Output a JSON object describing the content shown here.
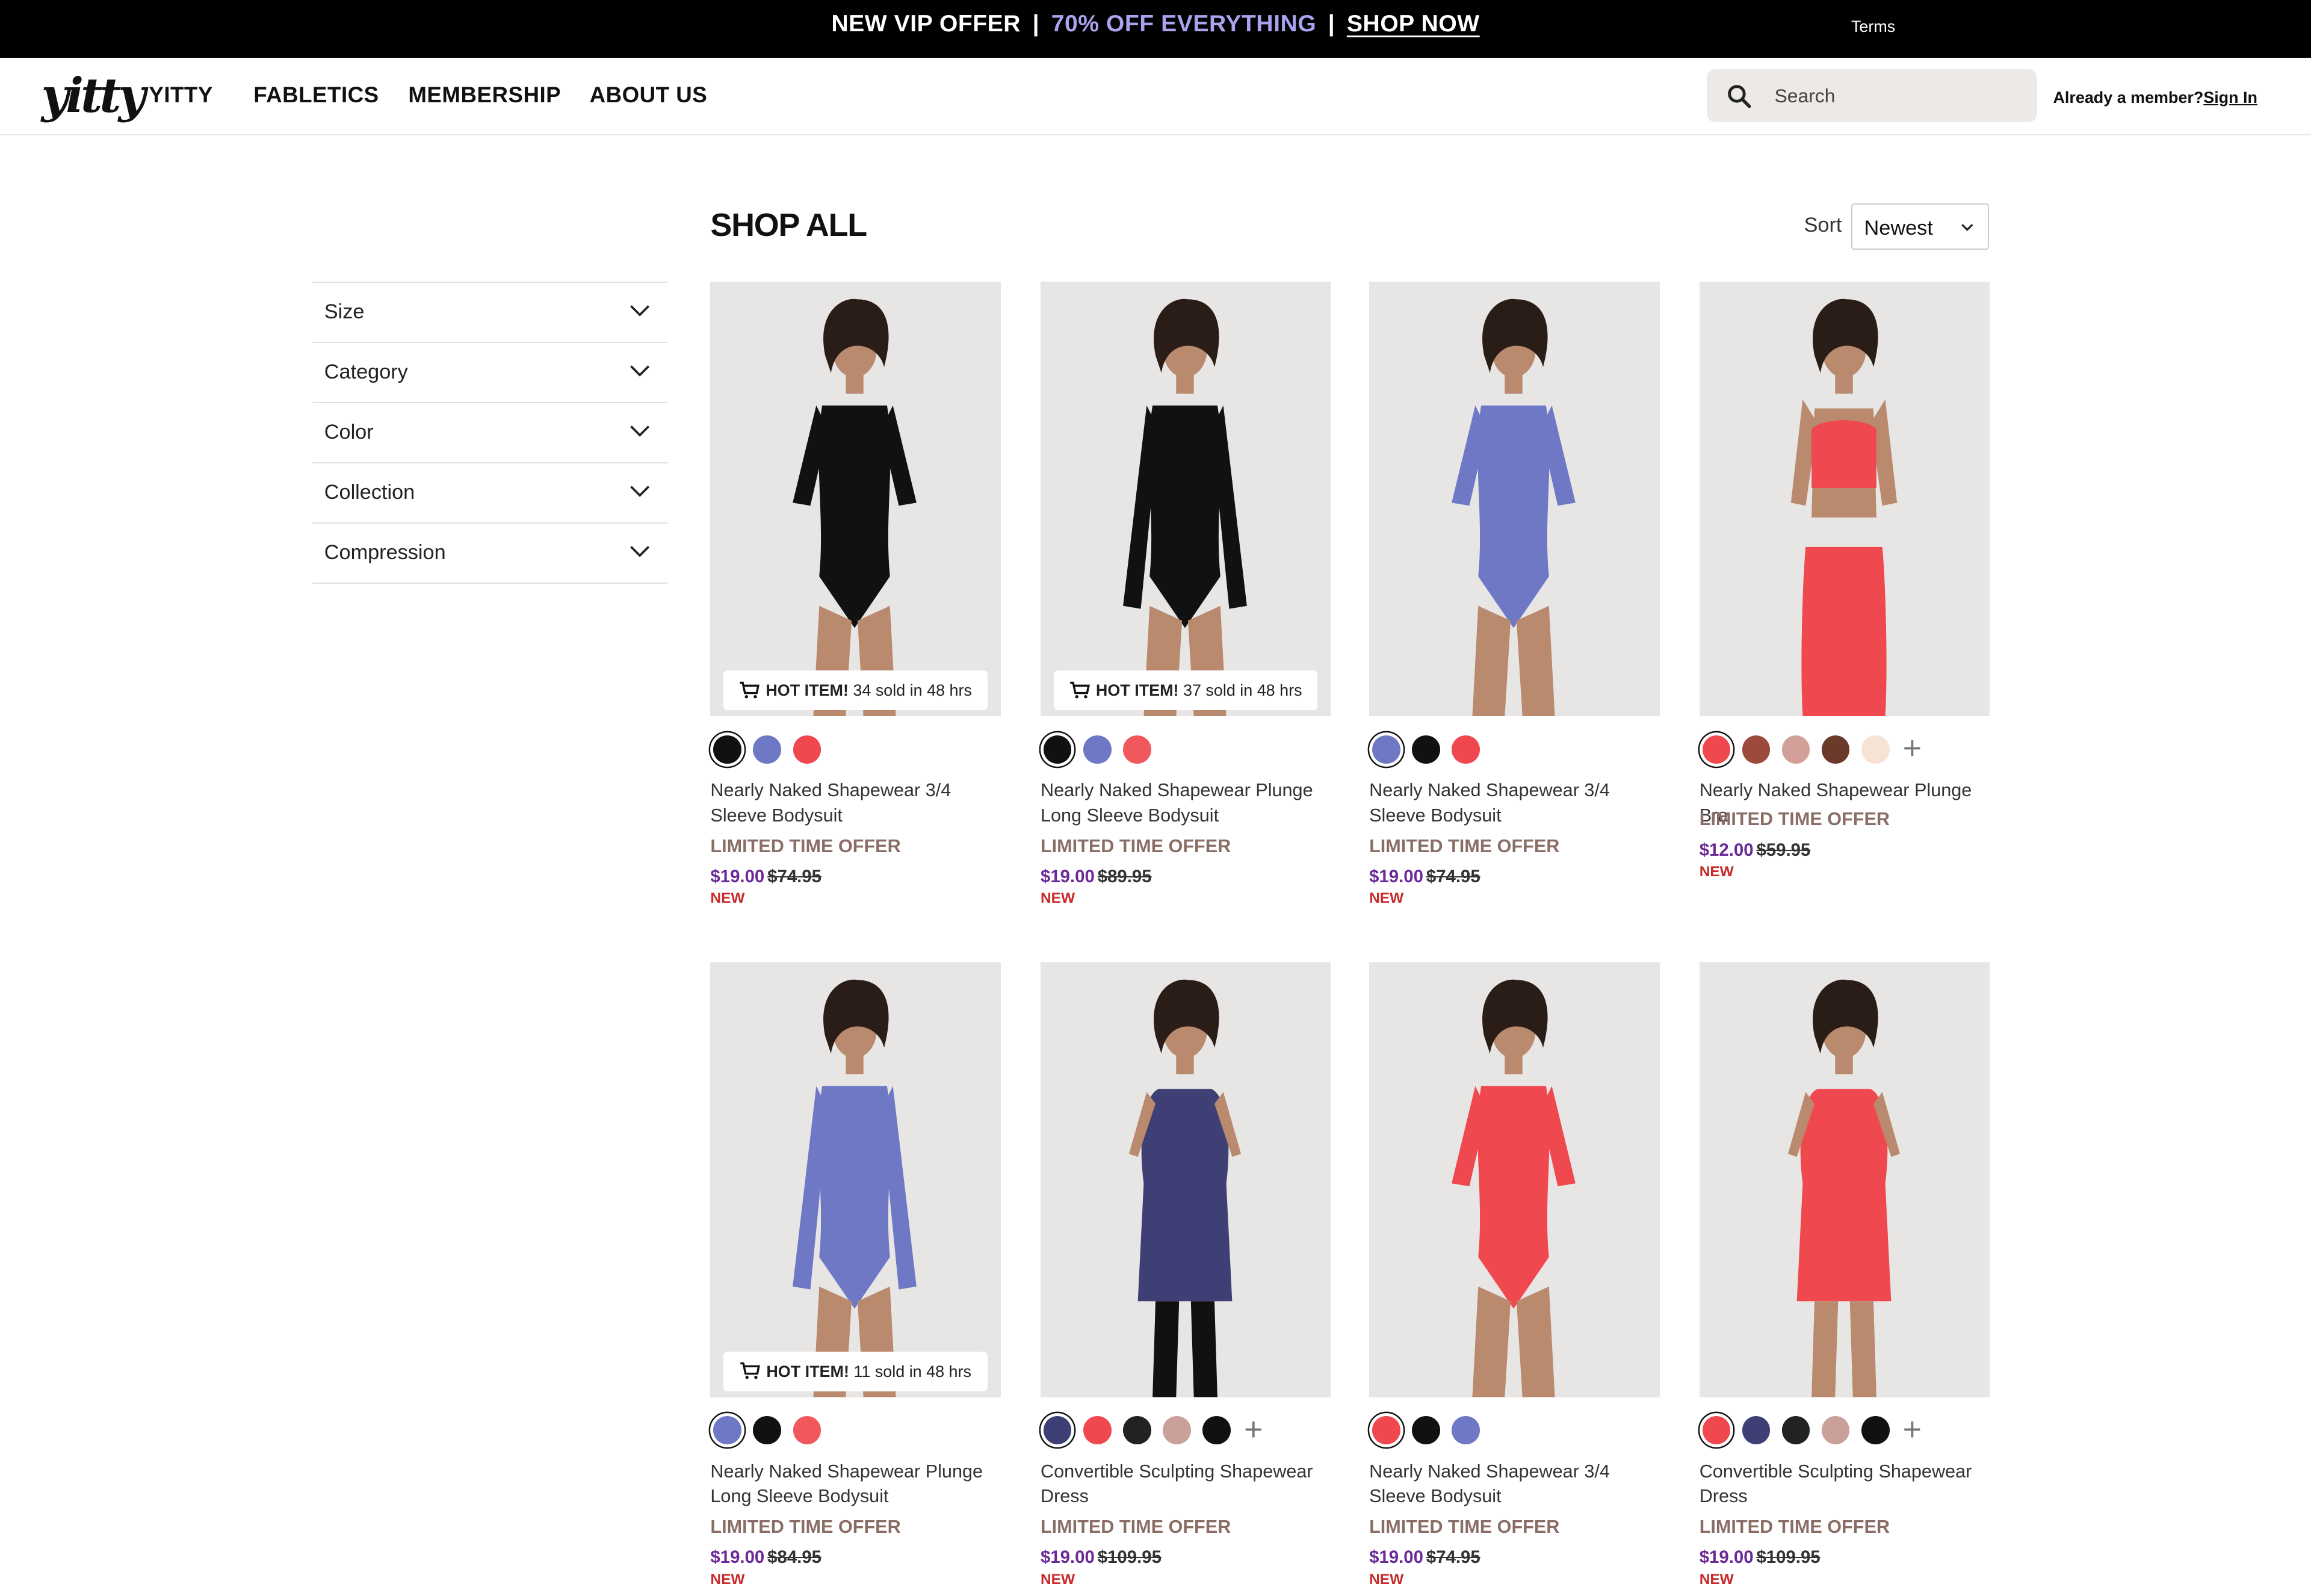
{
  "promo": {
    "part1": "NEW VIP OFFER",
    "sep": "|",
    "part2": "70% OFF EVERYTHING",
    "cta": "SHOP NOW",
    "terms": "Terms",
    "accent_color": "#a9a2ee"
  },
  "header": {
    "logo": "yitty",
    "nav": [
      "YITTY",
      "FABLETICS",
      "MEMBERSHIP",
      "ABOUT US"
    ],
    "search_placeholder": "Search",
    "member_text": "Already a member?",
    "signin": "Sign In"
  },
  "filters": [
    "Size",
    "Category",
    "Color",
    "Collection",
    "Compression"
  ],
  "main": {
    "title": "SHOP ALL",
    "sort_label": "Sort",
    "sort_value": "Newest"
  },
  "colors": {
    "price_now": "#6b2a98",
    "lto": "#8a6e66",
    "new_tag": "#c92a2a"
  },
  "products": [
    {
      "name": "Nearly Naked Shapewear 3/4 Sleeve Bodysuit",
      "offer": "LIMITED TIME OFFER",
      "price": "$19.00",
      "was": "$74.95",
      "tag": "NEW",
      "hot": {
        "label": "HOT ITEM!",
        "text": "34 sold in 48 hrs"
      },
      "image_icon": "model-black-bodysuit",
      "swatches": [
        "#111111",
        "#6e78c4",
        "#f0484f"
      ]
    },
    {
      "name": "Nearly Naked Shapewear Plunge Long Sleeve Bodysuit",
      "offer": "LIMITED TIME OFFER",
      "price": "$19.00",
      "was": "$89.95",
      "tag": "NEW",
      "hot": {
        "label": "HOT ITEM!",
        "text": "37 sold in 48 hrs"
      },
      "image_icon": "model-black-long-sleeve",
      "swatches": [
        "#111111",
        "#6e78c4",
        "#f0585d"
      ]
    },
    {
      "name": "Nearly Naked Shapewear 3/4 Sleeve Bodysuit",
      "offer": "LIMITED TIME OFFER",
      "price": "$19.00",
      "was": "$74.95",
      "tag": "NEW",
      "hot": null,
      "image_icon": "model-blue-bodysuit",
      "swatches": [
        "#6e78c4",
        "#111111",
        "#f0484f"
      ]
    },
    {
      "name": "Nearly Naked Shapewear Plunge Bra",
      "offer": "LIMITED TIME OFFER",
      "price": "$12.00",
      "was": "$59.95",
      "tag": "NEW",
      "hot": null,
      "image_icon": "model-coral-bra",
      "swatches": [
        "#f0484f",
        "#9b4a3c",
        "#d2a098",
        "#6a3a2a",
        "#f7e3d6"
      ],
      "more": "+"
    },
    {
      "name": "Nearly Naked Shapewear Plunge Long Sleeve Bodysuit",
      "offer": "LIMITED TIME OFFER",
      "price": "$19.00",
      "was": "$84.95",
      "tag": "NEW",
      "hot": {
        "label": "HOT ITEM!",
        "text": "11 sold in 48 hrs"
      },
      "image_icon": "model-blue-long-sleeve",
      "swatches": [
        "#6e78c4",
        "#111111",
        "#f0585d"
      ]
    },
    {
      "name": "Convertible Sculpting Shapewear Dress",
      "offer": "LIMITED TIME OFFER",
      "price": "$19.00",
      "was": "$109.95",
      "tag": "NEW",
      "hot": null,
      "image_icon": "model-navy-dress",
      "swatches": [
        "#3e3f74",
        "#f0484f",
        "#222222",
        "#c9a09a",
        "#111111"
      ],
      "more": "+"
    },
    {
      "name": "Nearly Naked Shapewear 3/4 Sleeve Bodysuit",
      "offer": "LIMITED TIME OFFER",
      "price": "$19.00",
      "was": "$74.95",
      "tag": "NEW",
      "hot": null,
      "image_icon": "model-coral-bodysuit",
      "swatches": [
        "#f0484f",
        "#111111",
        "#6e78c4"
      ]
    },
    {
      "name": "Convertible Sculpting Shapewear Dress",
      "offer": "LIMITED TIME OFFER",
      "price": "$19.00",
      "was": "$109.95",
      "tag": "NEW",
      "hot": null,
      "image_icon": "model-coral-dress",
      "swatches": [
        "#f0484f",
        "#3e3f74",
        "#222222",
        "#c9a09a",
        "#111111"
      ],
      "more": "+"
    }
  ]
}
